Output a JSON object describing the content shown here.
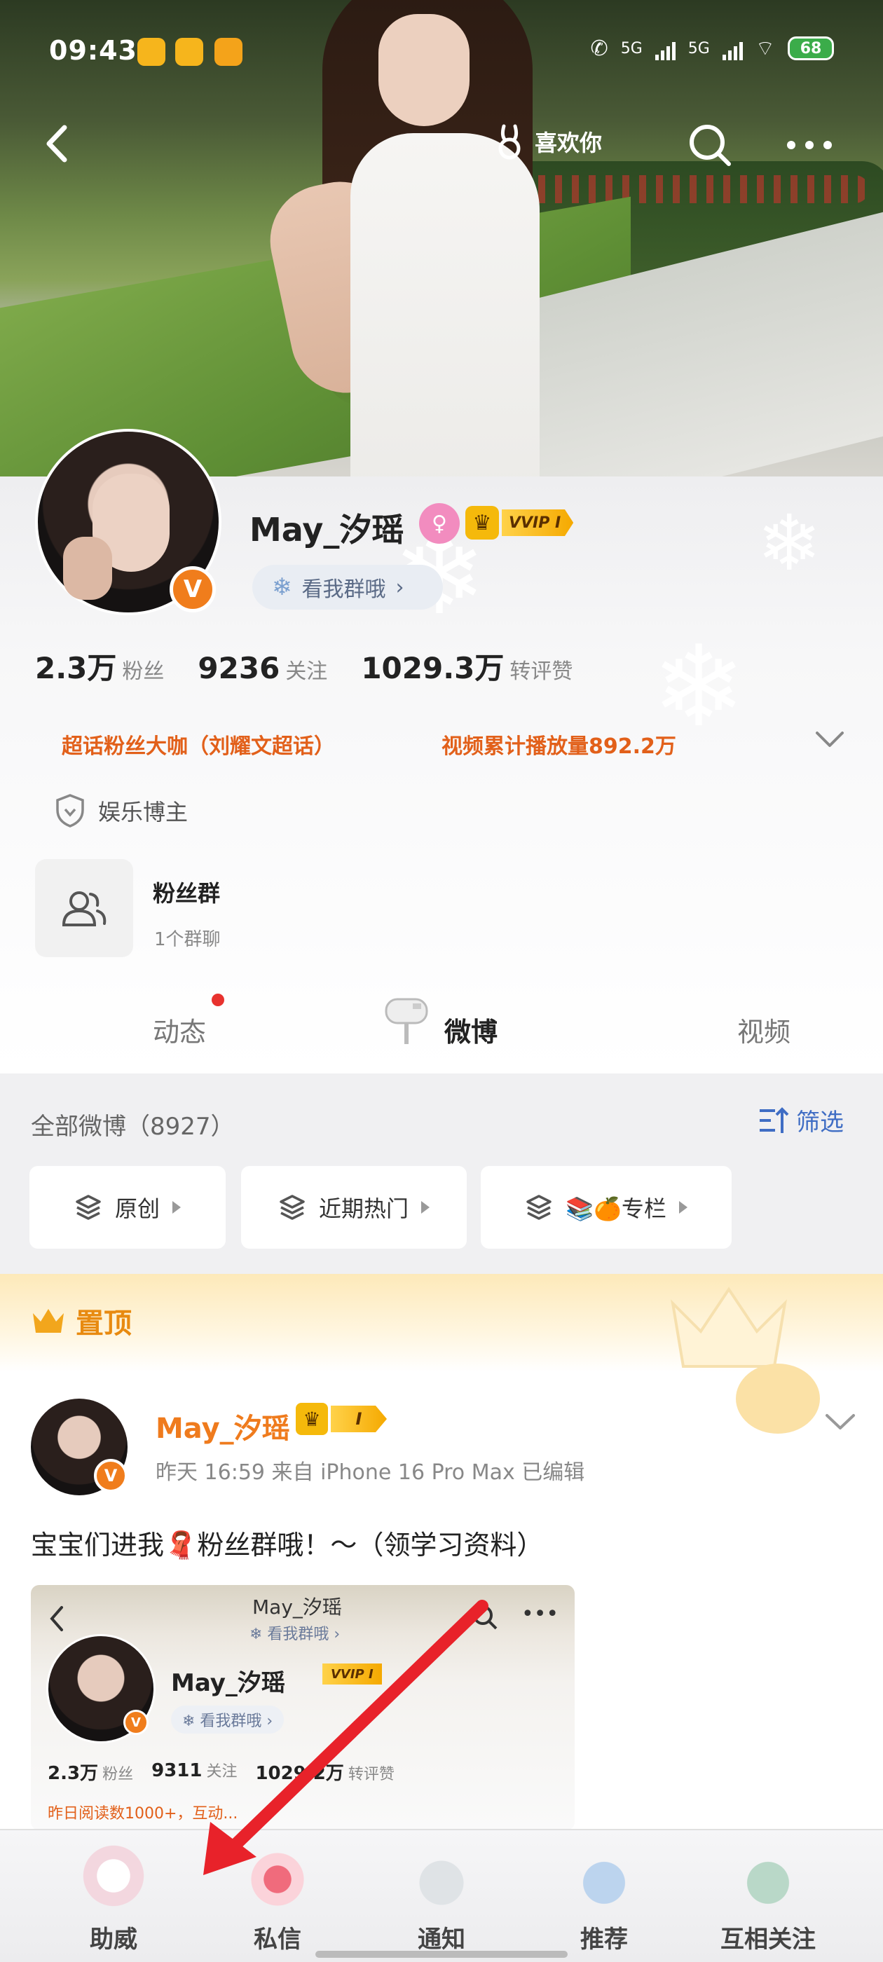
{
  "status_bar": {
    "time": "09:43",
    "network_1": "5G",
    "network_2": "5G",
    "battery": "68"
  },
  "header": {
    "like_you_label": "喜欢你"
  },
  "profile": {
    "name": "May_汐瑶",
    "vip_badge": "VVIP I",
    "group_pill": "看我群哦",
    "stats": [
      {
        "value": "2.3万",
        "label": "粉丝"
      },
      {
        "value": "9236",
        "label": "关注"
      },
      {
        "value": "1029.3万",
        "label": "转评赞"
      }
    ],
    "super_topic": "超话粉丝大咖（刘耀文超话）",
    "video_plays": "视频累计播放量892.2万",
    "role": "娱乐博主",
    "fan_group": {
      "title": "粉丝群",
      "subtitle": "1个群聊"
    }
  },
  "tabs": [
    {
      "label": "动态",
      "active": false,
      "has_dot": true
    },
    {
      "label": "微博",
      "active": true,
      "has_dot": false
    },
    {
      "label": "视频",
      "active": false,
      "has_dot": false
    }
  ],
  "weibo": {
    "all_label": "全部微博（8927）",
    "filter_label": "筛选",
    "chips": [
      "原创",
      "近期热门",
      "📚🍊专栏"
    ]
  },
  "pinned": {
    "label": "置顶",
    "post": {
      "author": "May_汐瑶",
      "vip_level": "I",
      "meta": "昨天 16:59   来自 iPhone 16 Pro Max   已编辑",
      "text": "宝宝们进我🧣粉丝群哦！～（领学习资料）",
      "thumbnail": {
        "title": "May_汐瑶",
        "sub": "❄ 看我群哦 ›",
        "name": "May_汐瑶",
        "vip": "VVIP I",
        "pill": "❄ 看我群哦 ›",
        "stats": [
          {
            "value": "2.3万",
            "label": "粉丝"
          },
          {
            "value": "9311",
            "label": "关注"
          },
          {
            "value": "1029.2万",
            "label": "转评赞"
          }
        ],
        "orange": "昨日阅读数1000+，互动..."
      }
    }
  },
  "bottom_nav": [
    {
      "label": "助威"
    },
    {
      "label": "私信"
    },
    {
      "label": "通知"
    },
    {
      "label": "推荐"
    },
    {
      "label": "互相关注"
    }
  ],
  "colors": {
    "accent_orange": "#e2601a",
    "link_blue": "#3f6dc4",
    "vip_gold": "#f5b90b",
    "arrow_red": "#e8222a"
  }
}
